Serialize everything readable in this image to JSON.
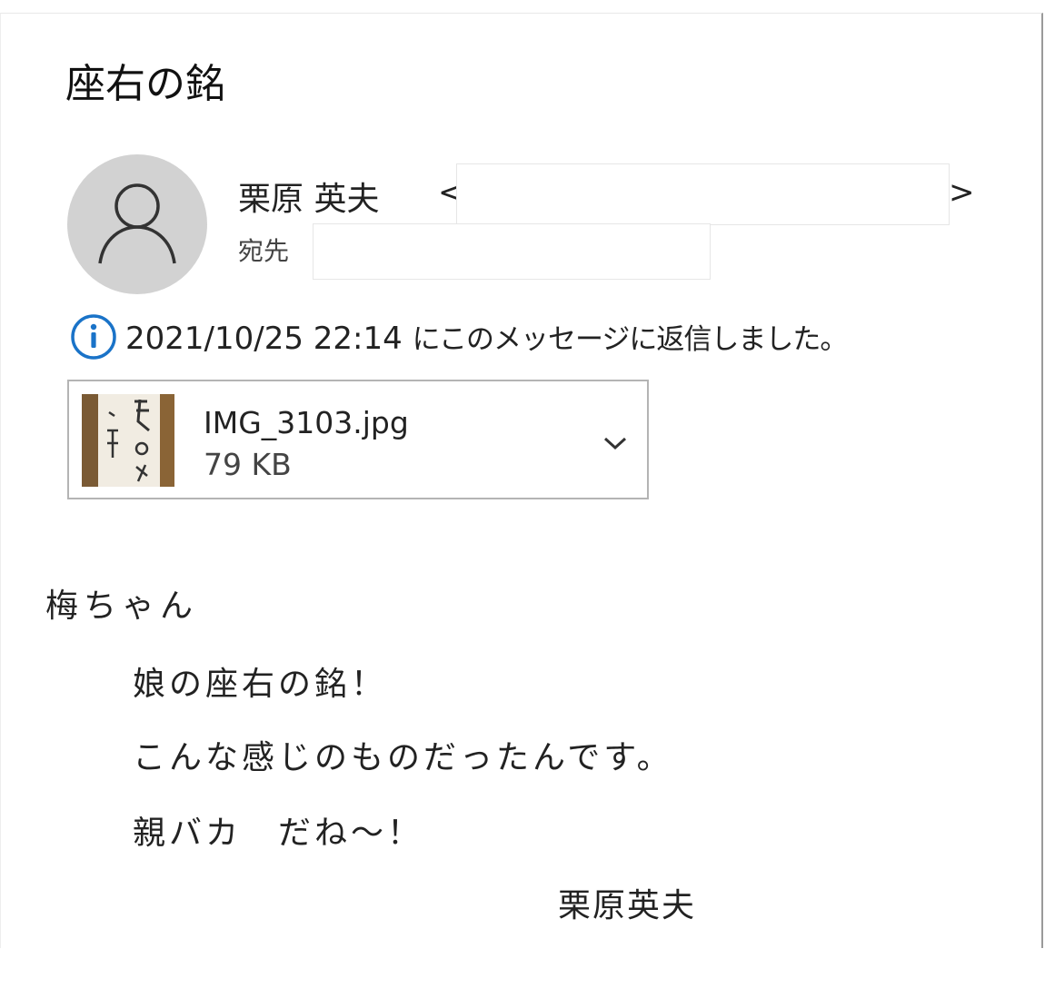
{
  "message": {
    "subject": "座右の銘",
    "sender": {
      "name": "栗原 英夫",
      "email_open": "<",
      "email_close": ">"
    },
    "to_label": "宛先",
    "reply_notice": {
      "timestamp": "2021/10/25 22:14",
      "text": "にこのメッセージに返信しました。"
    },
    "attachment": {
      "filename": "IMG_3103.jpg",
      "size": "79 KB"
    },
    "body": {
      "greeting": "梅ちゃん",
      "lines": [
        "娘の座右の銘！",
        "こんな感じのものだったんです。",
        "親バカ　だね～！"
      ],
      "signature": "栗原英夫"
    }
  },
  "icons": {
    "avatar": "person-icon",
    "info": "info-icon",
    "expand": "chevron-down-icon"
  },
  "colors": {
    "info_blue": "#1a73c8",
    "avatar_bg": "#d2d2d2"
  }
}
